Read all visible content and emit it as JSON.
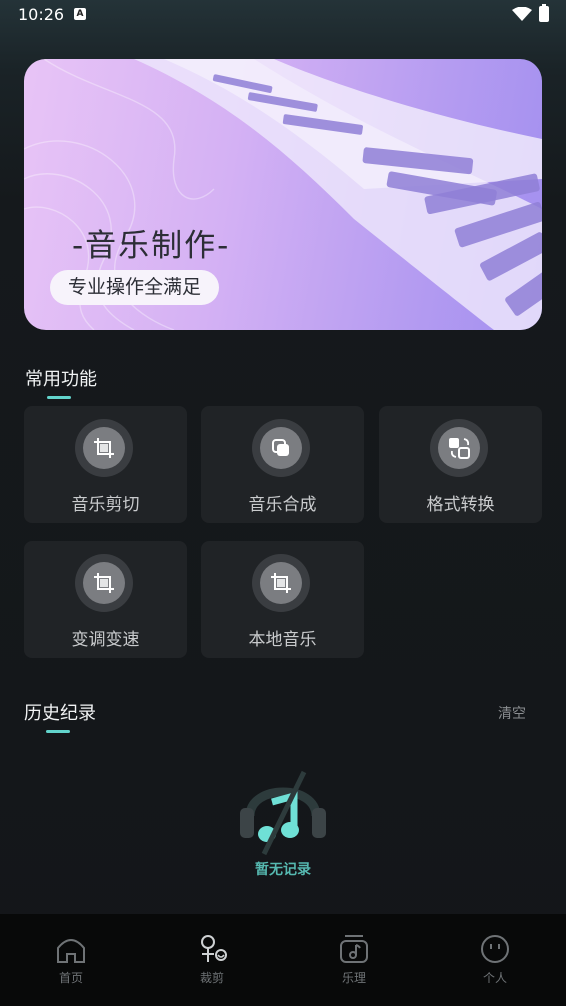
{
  "status_bar": {
    "time": "10:26",
    "notification_icon": "A"
  },
  "banner": {
    "title": "-音乐制作-",
    "subtitle": "专业操作全满足"
  },
  "common_functions": {
    "title": "常用功能",
    "items": [
      {
        "label": "音乐剪切",
        "icon": "crop-icon"
      },
      {
        "label": "音乐合成",
        "icon": "merge-icon"
      },
      {
        "label": "格式转换",
        "icon": "convert-icon"
      },
      {
        "label": "变调变速",
        "icon": "crop-icon"
      },
      {
        "label": "本地音乐",
        "icon": "crop-icon"
      }
    ]
  },
  "history": {
    "title": "历史纪录",
    "clear_label": "清空",
    "empty_text": "暂无记录"
  },
  "tabbar": {
    "items": [
      {
        "label": "首页",
        "icon": "home-icon"
      },
      {
        "label": "裁剪",
        "icon": "cut-icon"
      },
      {
        "label": "乐理",
        "icon": "music-note-icon"
      },
      {
        "label": "个人",
        "icon": "profile-icon"
      }
    ]
  },
  "colors": {
    "accent": "#62d4cc",
    "card": "#202326",
    "background": "#141619"
  }
}
